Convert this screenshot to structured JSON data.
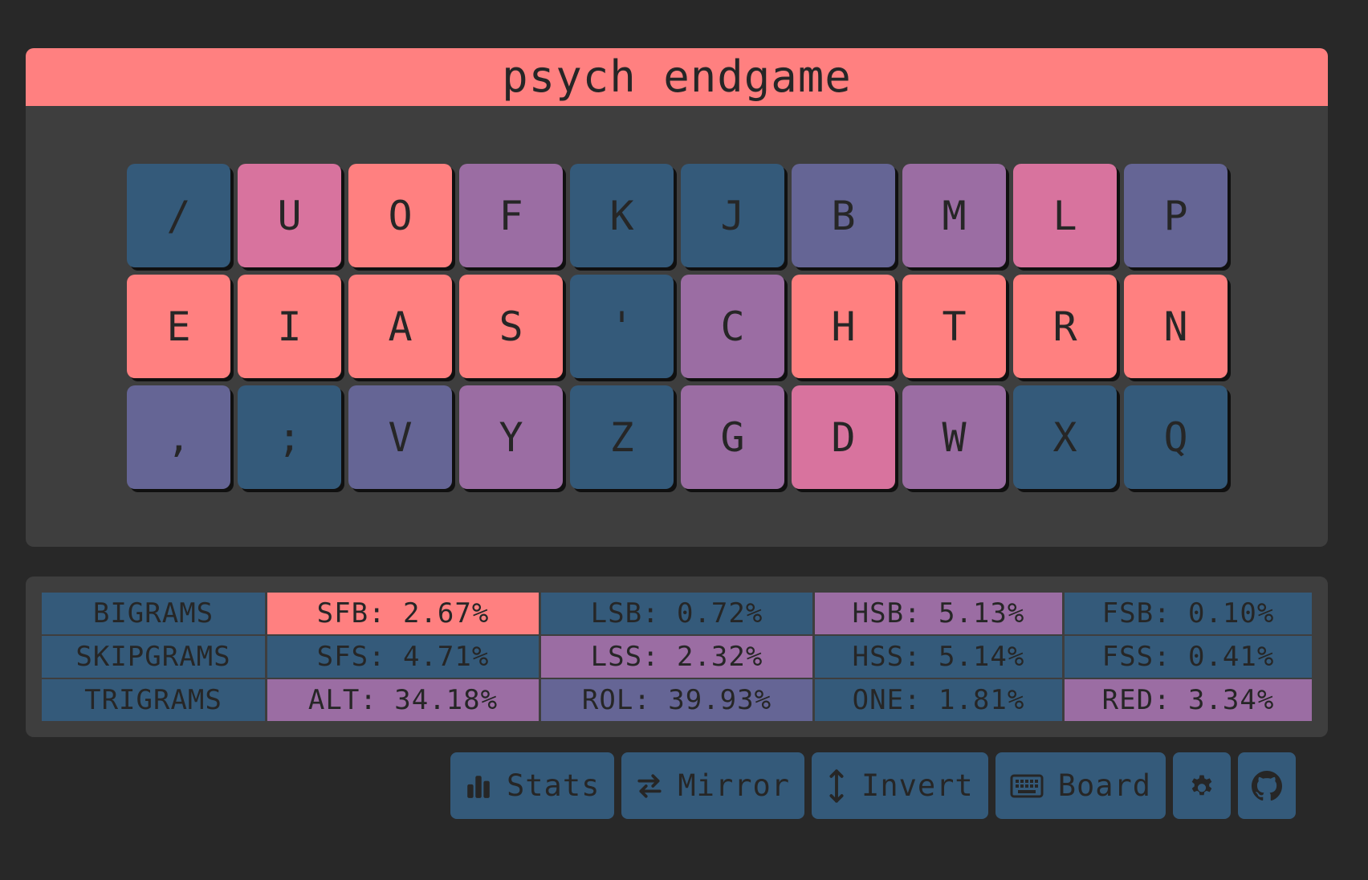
{
  "title": "psych endgame",
  "colors": {
    "page_bg": "#282828",
    "panel_bg": "#3e3e3e",
    "coral": "#ff8080",
    "pink": "#d8739e",
    "purple": "#9b6da3",
    "indigo": "#656595",
    "navy": "#345a7a"
  },
  "keyboard": {
    "rows": [
      [
        {
          "label": "/",
          "color": "#345a7a"
        },
        {
          "label": "U",
          "color": "#d8739e"
        },
        {
          "label": "O",
          "color": "#ff8080"
        },
        {
          "label": "F",
          "color": "#9b6da3"
        },
        {
          "label": "K",
          "color": "#345a7a"
        },
        {
          "label": "J",
          "color": "#345a7a"
        },
        {
          "label": "B",
          "color": "#656595"
        },
        {
          "label": "M",
          "color": "#9b6da3"
        },
        {
          "label": "L",
          "color": "#d8739e"
        },
        {
          "label": "P",
          "color": "#656595"
        }
      ],
      [
        {
          "label": "E",
          "color": "#ff8080"
        },
        {
          "label": "I",
          "color": "#ff8080"
        },
        {
          "label": "A",
          "color": "#ff8080"
        },
        {
          "label": "S",
          "color": "#ff8080"
        },
        {
          "label": "'",
          "color": "#345a7a"
        },
        {
          "label": "C",
          "color": "#9b6da3"
        },
        {
          "label": "H",
          "color": "#ff8080"
        },
        {
          "label": "T",
          "color": "#ff8080"
        },
        {
          "label": "R",
          "color": "#ff8080"
        },
        {
          "label": "N",
          "color": "#ff8080"
        }
      ],
      [
        {
          "label": ",",
          "color": "#656595"
        },
        {
          "label": ";",
          "color": "#345a7a"
        },
        {
          "label": "V",
          "color": "#656595"
        },
        {
          "label": "Y",
          "color": "#9b6da3"
        },
        {
          "label": "Z",
          "color": "#345a7a"
        },
        {
          "label": "G",
          "color": "#9b6da3"
        },
        {
          "label": "D",
          "color": "#d8739e"
        },
        {
          "label": "W",
          "color": "#9b6da3"
        },
        {
          "label": "X",
          "color": "#345a7a"
        },
        {
          "label": "Q",
          "color": "#345a7a"
        }
      ]
    ]
  },
  "stats": {
    "rows": [
      {
        "label": "BIGRAMS",
        "cells": [
          {
            "text": "SFB: 2.67%",
            "color": "#ff8080"
          },
          {
            "text": "LSB: 0.72%",
            "color": "#345a7a"
          },
          {
            "text": "HSB: 5.13%",
            "color": "#9b6da3"
          },
          {
            "text": "FSB: 0.10%",
            "color": "#345a7a"
          }
        ]
      },
      {
        "label": "SKIPGRAMS",
        "cells": [
          {
            "text": "SFS: 4.71%",
            "color": "#345a7a"
          },
          {
            "text": "LSS: 2.32%",
            "color": "#9b6da3"
          },
          {
            "text": "HSS: 5.14%",
            "color": "#345a7a"
          },
          {
            "text": "FSS: 0.41%",
            "color": "#345a7a"
          }
        ]
      },
      {
        "label": "TRIGRAMS",
        "cells": [
          {
            "text": "ALT: 34.18%",
            "color": "#9b6da3"
          },
          {
            "text": "ROL: 39.93%",
            "color": "#656595"
          },
          {
            "text": "ONE: 1.81%",
            "color": "#345a7a"
          },
          {
            "text": "RED: 3.34%",
            "color": "#9b6da3"
          }
        ]
      }
    ]
  },
  "toolbar": {
    "buttons": [
      {
        "id": "stats",
        "label": "Stats",
        "icon": "bar-chart-icon"
      },
      {
        "id": "mirror",
        "label": "Mirror",
        "icon": "swap-arrows-icon"
      },
      {
        "id": "invert",
        "label": "Invert",
        "icon": "vertical-arrows-icon"
      },
      {
        "id": "board",
        "label": "Board",
        "icon": "keyboard-icon"
      },
      {
        "id": "settings",
        "label": "",
        "icon": "gear-icon"
      },
      {
        "id": "github",
        "label": "",
        "icon": "github-icon"
      }
    ]
  }
}
